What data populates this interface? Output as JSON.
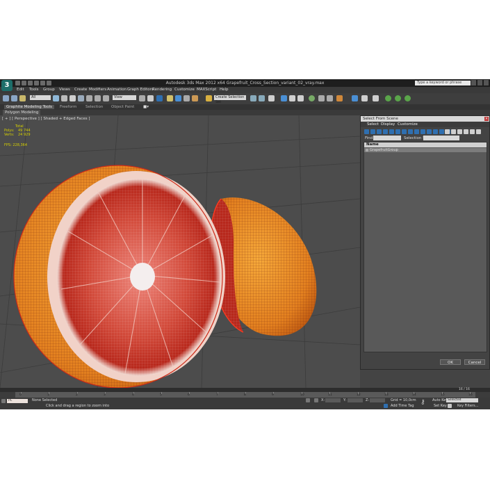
{
  "app": {
    "title": "Autodesk 3ds Max 2012 x64    Grapefruit_Cross_Section_variant_02_vray.max",
    "logo": "3",
    "search_placeholder": "Type a keyword or phrase"
  },
  "menu": [
    "Edit",
    "Tools",
    "Group",
    "Views",
    "Create",
    "Modifiers",
    "Animation",
    "Graph Editors",
    "Rendering",
    "Customize",
    "MAXScript",
    "Help"
  ],
  "toolbar": {
    "selection_filter": "All",
    "coord_system": "View",
    "named_selection": "Create Selection Set"
  },
  "ribbon": {
    "tabs": [
      "Graphite Modeling Tools",
      "Freeform",
      "Selection",
      "Object Paint"
    ],
    "panel": "Polygon Modeling"
  },
  "viewport": {
    "label": "[ + ] [ Perspective ] [ Shaded + Edged Faces ]",
    "stats_header": "Total",
    "stats": [
      {
        "key": "Polys:",
        "value": "49 744"
      },
      {
        "key": "Verts:",
        "value": "24 929"
      }
    ],
    "fps_label": "FPS:",
    "fps_value": "228,364"
  },
  "dialog": {
    "title": "Select From Scene",
    "close": "×",
    "menu": [
      "Select",
      "Display",
      "Customize"
    ],
    "find_label": "Find:",
    "selset_label": "Selection Set:",
    "column_header": "Name",
    "items": [
      "GrapefruitGroup"
    ],
    "ok": "OK",
    "cancel": "Cancel"
  },
  "timeline": {
    "frame_counter": "16 / 16",
    "ticks": [
      "0",
      "1",
      "2",
      "3",
      "4",
      "5",
      "6",
      "7",
      "8",
      "9",
      "10",
      "11",
      "12",
      "13",
      "14",
      "15",
      "16"
    ]
  },
  "statusbar": {
    "none_selected": "None Selected",
    "hint": "Click and drag a region to zoom into",
    "x_label": "X:",
    "y_label": "Y:",
    "z_label": "Z:",
    "grid": "Grid = 10,0cm",
    "auto_key": "Auto Key",
    "key_mode": "Selected",
    "set_key": "Set Key",
    "key_filters": "Key Filters...",
    "add_time_tag": "Add Time Tag",
    "script_prompt": "PL"
  },
  "colors": {
    "peel": "#e98a24",
    "flesh": "#c0342a",
    "wire": "#ffffff",
    "stats": "#d6d000",
    "dialog_accent": "#2f6fb0"
  }
}
